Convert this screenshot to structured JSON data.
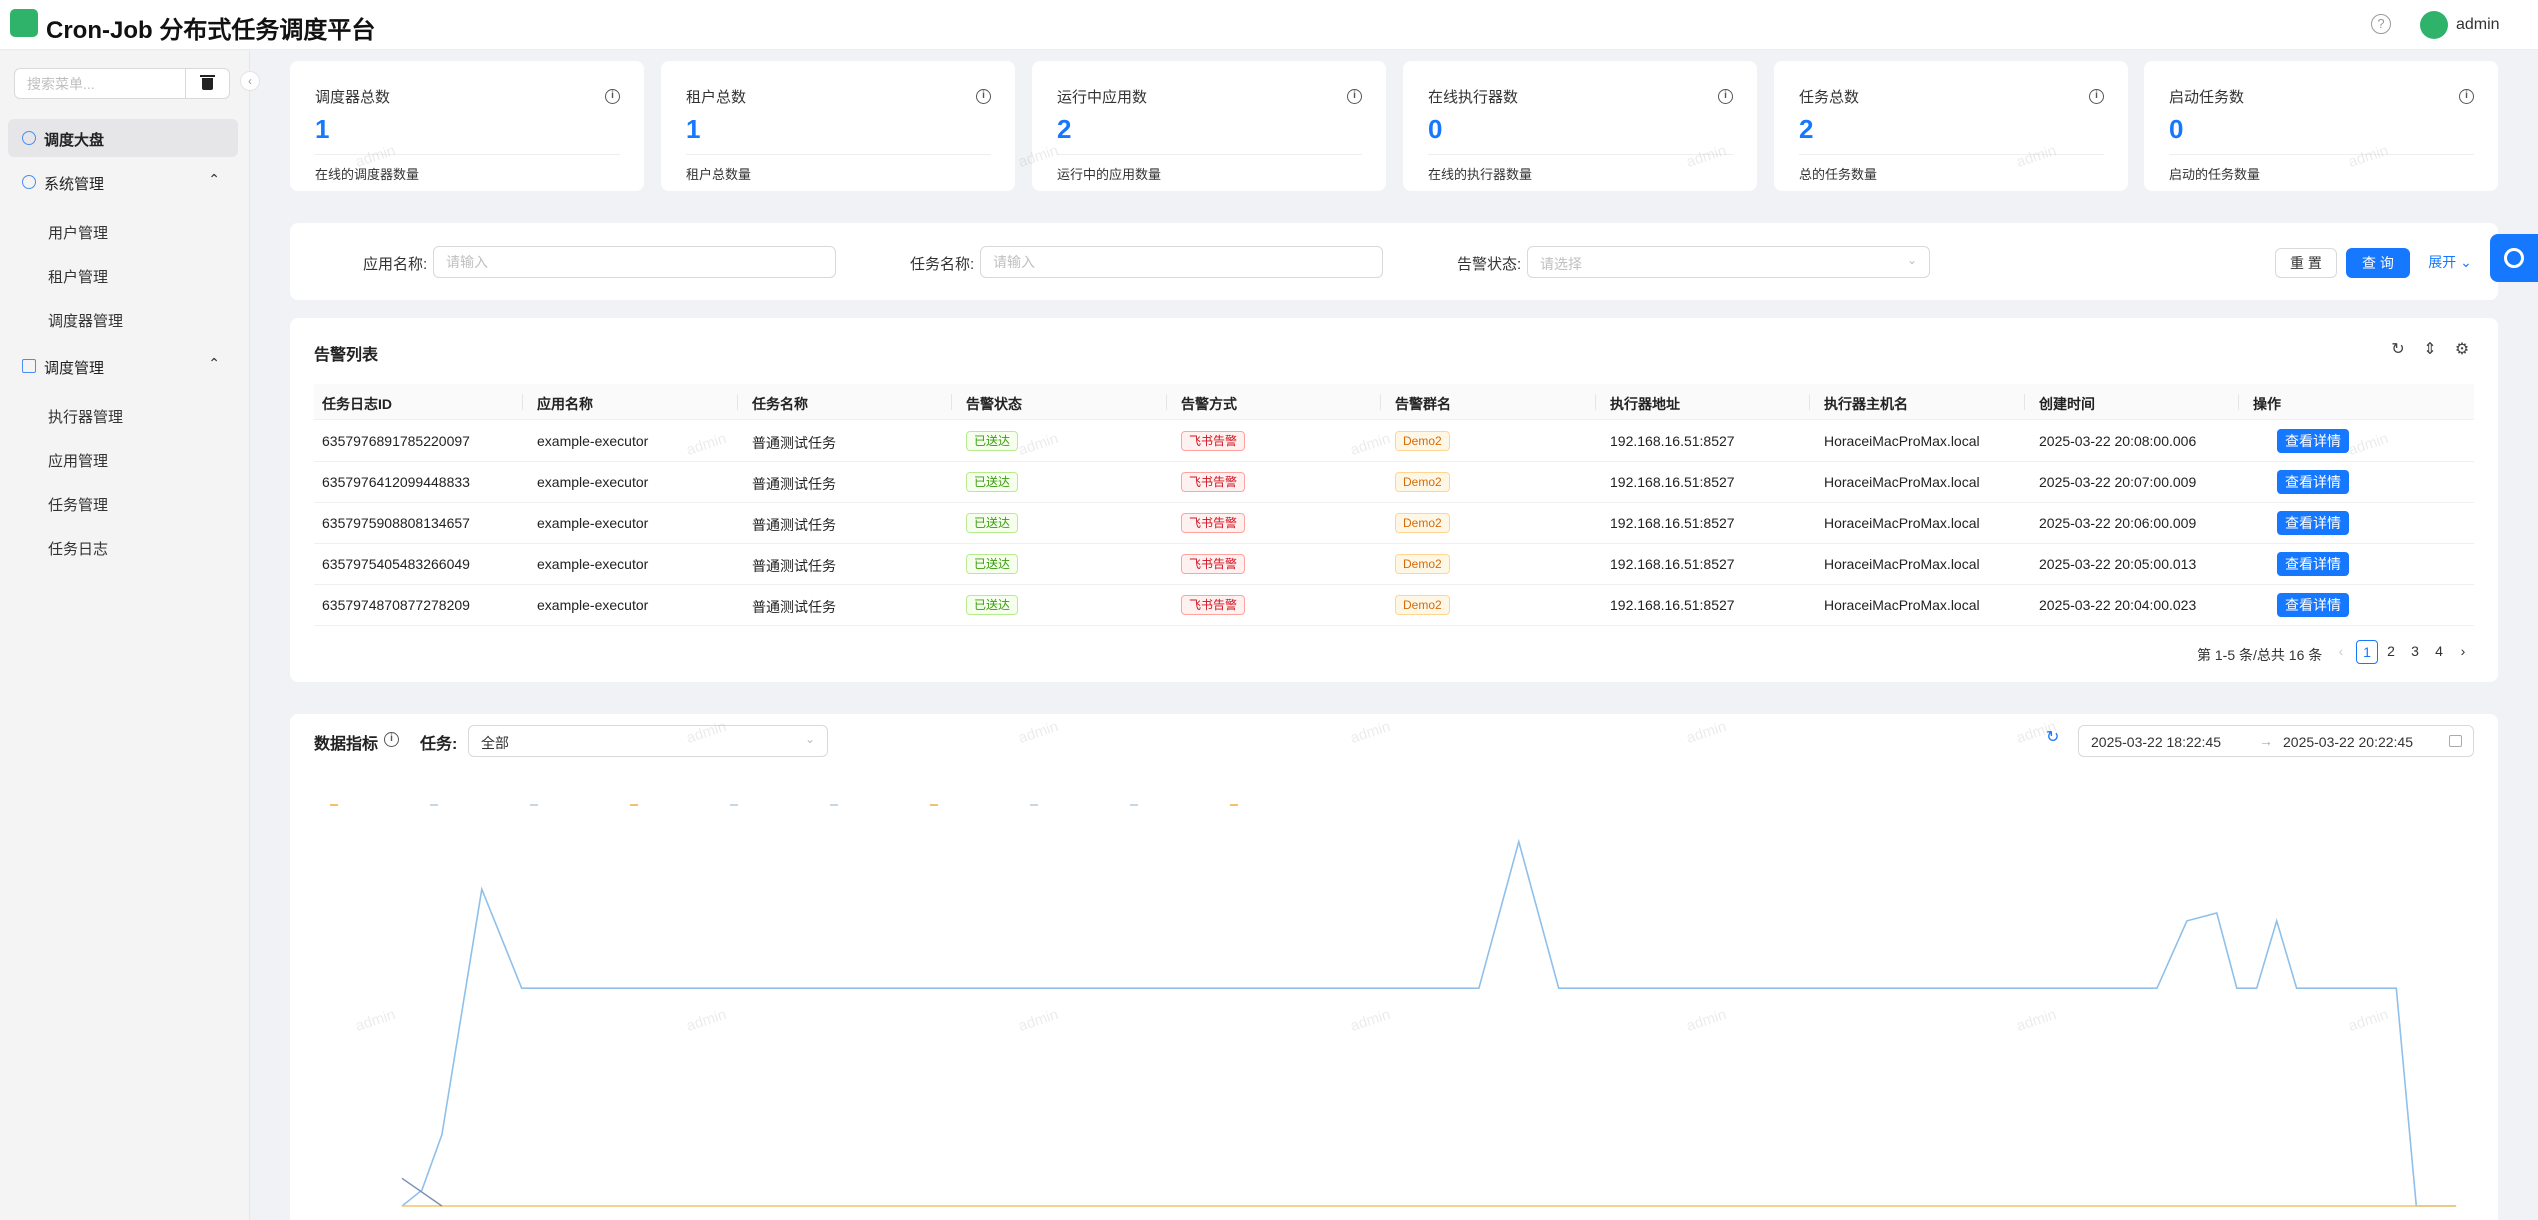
{
  "header": {
    "title": "Cron-Job 分布式任务调度平台",
    "help_icon": "question-circle-icon",
    "username": "admin"
  },
  "sidebar": {
    "search_placeholder": "搜索菜单...",
    "items": [
      {
        "label": "调度大盘",
        "icon": "dashboard-icon",
        "active": true
      },
      {
        "label": "系统管理",
        "icon": "gear-icon",
        "children": [
          "用户管理",
          "租户管理",
          "调度器管理"
        ]
      },
      {
        "label": "调度管理",
        "icon": "grid-icon",
        "children": [
          "执行器管理",
          "应用管理",
          "任务管理",
          "任务日志"
        ]
      }
    ]
  },
  "stats": [
    {
      "title": "调度器总数",
      "value": "1",
      "desc": "在线的调度器数量"
    },
    {
      "title": "租户总数",
      "value": "1",
      "desc": "租户总数量"
    },
    {
      "title": "运行中应用数",
      "value": "2",
      "desc": "运行中的应用数量"
    },
    {
      "title": "在线执行器数",
      "value": "0",
      "desc": "在线的执行器数量"
    },
    {
      "title": "任务总数",
      "value": "2",
      "desc": "总的任务数量"
    },
    {
      "title": "启动任务数",
      "value": "0",
      "desc": "启动的任务数量"
    }
  ],
  "filters": {
    "app_label": "应用名称:",
    "app_placeholder": "请输入",
    "task_label": "任务名称:",
    "task_placeholder": "请输入",
    "status_label": "告警状态:",
    "status_placeholder": "请选择",
    "reset": "重 置",
    "query": "查 询",
    "expand": "展开"
  },
  "alerts": {
    "title": "告警列表",
    "columns": [
      "任务日志ID",
      "应用名称",
      "任务名称",
      "告警状态",
      "告警方式",
      "告警群名",
      "执行器地址",
      "执行器主机名",
      "创建时间",
      "操作"
    ],
    "rows": [
      {
        "id": "6357976891785220097",
        "app": "example-executor",
        "task": "普通测试任务",
        "status": "已送达",
        "method": "飞书告警",
        "group": "Demo2",
        "address": "192.168.16.51:8527",
        "host": "HoraceiMacProMax.local",
        "time": "2025-03-22 20:08:00.006",
        "action": "查看详情"
      },
      {
        "id": "6357976412099448833",
        "app": "example-executor",
        "task": "普通测试任务",
        "status": "已送达",
        "method": "飞书告警",
        "group": "Demo2",
        "address": "192.168.16.51:8527",
        "host": "HoraceiMacProMax.local",
        "time": "2025-03-22 20:07:00.009",
        "action": "查看详情"
      },
      {
        "id": "6357975908808134657",
        "app": "example-executor",
        "task": "普通测试任务",
        "status": "已送达",
        "method": "飞书告警",
        "group": "Demo2",
        "address": "192.168.16.51:8527",
        "host": "HoraceiMacProMax.local",
        "time": "2025-03-22 20:06:00.009",
        "action": "查看详情"
      },
      {
        "id": "6357975405483266049",
        "app": "example-executor",
        "task": "普通测试任务",
        "status": "已送达",
        "method": "飞书告警",
        "group": "Demo2",
        "address": "192.168.16.51:8527",
        "host": "HoraceiMacProMax.local",
        "time": "2025-03-22 20:05:00.013",
        "action": "查看详情"
      },
      {
        "id": "6357974870877278209",
        "app": "example-executor",
        "task": "普通测试任务",
        "status": "已送达",
        "method": "飞书告警",
        "group": "Demo2",
        "address": "192.168.16.51:8527",
        "host": "HoraceiMacProMax.local",
        "time": "2025-03-22 20:04:00.023",
        "action": "查看详情"
      }
    ],
    "pagination": {
      "summary": "第 1-5 条/总共 16 条",
      "pages": [
        "1",
        "2",
        "3",
        "4"
      ],
      "current": "1"
    }
  },
  "metrics": {
    "title": "数据指标",
    "task_label": "任务:",
    "task_value": "全部",
    "range_start": "2025-03-22 18:22:45",
    "range_end": "2025-03-22 20:22:45",
    "range_separator": "→"
  },
  "watermark_text": "admin",
  "colors": {
    "primary": "#1677ff",
    "brand": "#2fb36b",
    "line_blue": "#8fc0ea",
    "line_orange": "#f5c26b"
  },
  "chart_data": {
    "type": "line",
    "title": "",
    "xlabel": "",
    "ylabel": "",
    "legend": "top-left",
    "grid": false,
    "x_range": [
      0,
      100
    ],
    "ylim": [
      0,
      100
    ],
    "series": [
      {
        "color": "#8fc0ea",
        "points": [
          [
            0,
            0
          ],
          [
            1,
            4
          ],
          [
            2,
            18
          ],
          [
            4,
            80
          ],
          [
            6,
            55
          ],
          [
            8,
            55
          ],
          [
            20,
            55
          ],
          [
            40,
            55
          ],
          [
            54,
            55
          ],
          [
            56,
            92
          ],
          [
            58,
            55
          ],
          [
            60,
            55
          ],
          [
            80,
            55
          ],
          [
            88,
            55
          ],
          [
            89.5,
            72
          ],
          [
            91,
            74
          ],
          [
            92,
            55
          ],
          [
            93,
            55
          ],
          [
            94,
            72
          ],
          [
            95,
            55
          ],
          [
            96,
            55
          ],
          [
            98,
            55
          ],
          [
            100,
            55
          ],
          [
            101,
            0
          ],
          [
            103,
            0
          ]
        ]
      },
      {
        "color": "#f5c26b",
        "points": [
          [
            0,
            0
          ],
          [
            103,
            0
          ]
        ]
      },
      {
        "color": "#7a8fb3",
        "points": [
          [
            0,
            7
          ],
          [
            2,
            0
          ]
        ]
      }
    ]
  }
}
